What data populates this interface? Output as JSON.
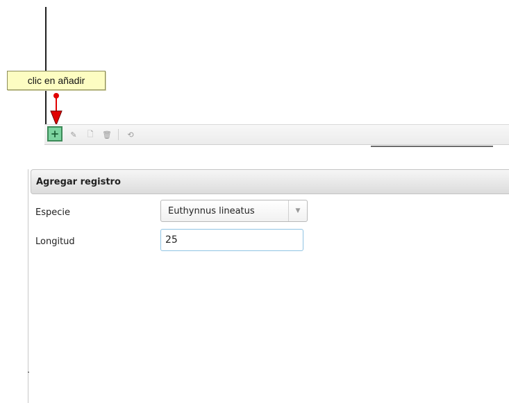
{
  "callout": {
    "text": "clic en añadir"
  },
  "toolbar": {
    "add_glyph": "+",
    "edit_glyph": "✎",
    "view_glyph": "🗋",
    "delete_glyph": "🗑",
    "refresh_glyph": "⟲",
    "icons": [
      "plus-icon",
      "pencil-icon",
      "document-icon",
      "trash-icon",
      "refresh-icon"
    ]
  },
  "form": {
    "title": "Agregar registro",
    "fields": [
      {
        "label": "Especie",
        "value": "Euthynnus lineatus"
      },
      {
        "label": "Longitud",
        "value": "25"
      }
    ]
  },
  "colors": {
    "callout_bg": "#fdfdc2",
    "arrow": "#e00000",
    "add_button": "#7dd3a0",
    "input_focus_border": "#8fc3e3"
  }
}
